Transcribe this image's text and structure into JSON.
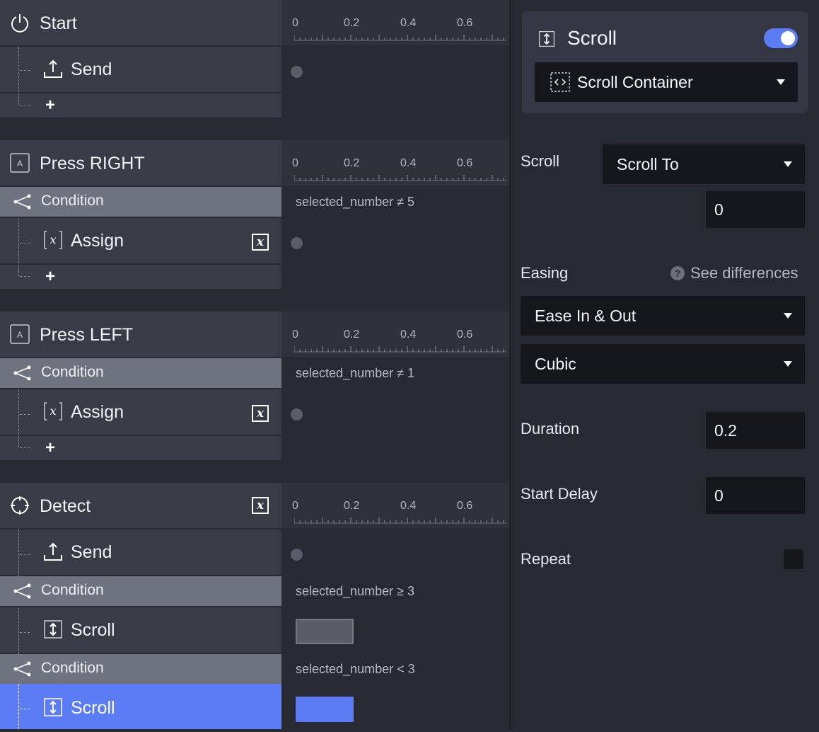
{
  "events": [
    {
      "title": "Start",
      "icon": "power-icon"
    },
    {
      "title": "Press RIGHT",
      "icon": "key-a-icon"
    },
    {
      "title": "Press LEFT",
      "icon": "key-a-icon"
    },
    {
      "title": "Detect",
      "icon": "crosshair-icon"
    }
  ],
  "actions": {
    "send1": "Send",
    "assign1": "Assign",
    "assign2": "Assign",
    "send2": "Send",
    "scroll1": "Scroll",
    "scroll2": "Scroll"
  },
  "conditions": {
    "c1": {
      "label": "Condition",
      "expr": "selected_number ≠ 5"
    },
    "c2": {
      "label": "Condition",
      "expr": "selected_number ≠ 1"
    },
    "c3": {
      "label": "Condition",
      "expr": "selected_number ≥ 3"
    },
    "c4": {
      "label": "Condition",
      "expr": "selected_number < 3"
    }
  },
  "add_label": "+",
  "variable_badge": "x",
  "ruler_labels": [
    "0",
    "0.2",
    "0.4",
    "0.6"
  ],
  "inspector": {
    "title": "Scroll",
    "enabled": true,
    "target": "Scroll Container",
    "scroll_label": "Scroll",
    "scroll_mode": "Scroll To",
    "scroll_value": "0",
    "easing_label": "Easing",
    "easing_help": "See differences",
    "easing_type": "Ease In & Out",
    "easing_curve": "Cubic",
    "duration_label": "Duration",
    "duration_value": "0.2",
    "delay_label": "Start Delay",
    "delay_value": "0",
    "repeat_label": "Repeat",
    "repeat_checked": false
  },
  "colors": {
    "accent": "#5b7cf5",
    "row_bg": "#393c47",
    "condition_bg": "#6f7380",
    "panel_bg": "#282a33"
  }
}
